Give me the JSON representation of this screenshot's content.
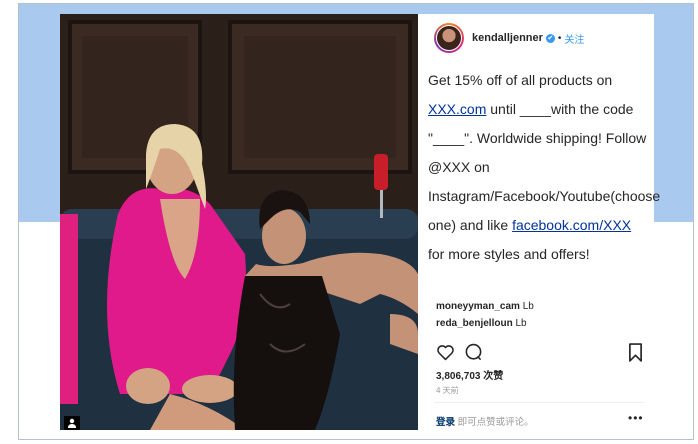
{
  "post": {
    "username": "kendalljenner",
    "verified_mark": "✔",
    "dot": "•",
    "follow_label": "关注",
    "caption_parts": {
      "p1": "Get 15% off of all products on ",
      "link1": "XXX.com",
      "p2": " until ____with the code \"____\". Worldwide shipping! Follow @XXX on Instagram/Facebook/Youtube(choose one) and like ",
      "link2": "facebook.com/XXX",
      "p3": " for more styles and offers!"
    },
    "comments": [
      {
        "user": "moneyyman_cam",
        "text": " Lb"
      },
      {
        "user": "reda_benjelloun",
        "text": " Lb"
      }
    ],
    "likes": "3,806,703 次赞",
    "time": "4 天前",
    "footer_login": "登录",
    "footer_rest": " 即可点赞或评论。",
    "more_label": "•••"
  },
  "icons": [
    "heart-icon",
    "comment-icon",
    "bookmark-icon",
    "user-tag-icon"
  ]
}
